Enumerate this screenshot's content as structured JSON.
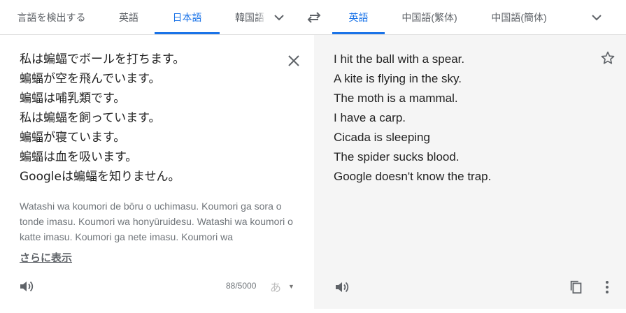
{
  "source_tabs": [
    {
      "label": "言語を検出する",
      "active": false
    },
    {
      "label": "英語",
      "active": false
    },
    {
      "label": "日本語",
      "active": true
    },
    {
      "label": "韓国語",
      "active": false
    }
  ],
  "target_tabs": [
    {
      "label": "英語",
      "active": true
    },
    {
      "label": "中国語(繁体)",
      "active": false
    },
    {
      "label": "中国語(簡体)",
      "active": false
    }
  ],
  "icons": {
    "source_more": "chevron-down-icon",
    "swap": "swap-arrows-icon",
    "target_more": "chevron-down-icon",
    "clear": "close-icon",
    "listen": "speaker-icon",
    "star": "star-outline-icon",
    "copy": "copy-icon",
    "more": "more-vert-icon"
  },
  "source": {
    "lines": [
      "私は蝙蝠でボールを打ちます。",
      "蝙蝠が空を飛んでいます。",
      "蝙蝠は哺乳類です。",
      "私は蝙蝠を飼っています。",
      "蝙蝠が寝ています。",
      "蝙蝠は血を吸います。",
      "Googleは蝙蝠を知りません。"
    ],
    "romanization": "Watashi wa koumori de bōru o uchimasu. Koumori ga sora o tonde imasu. Koumori wa honyūruidesu. Watashi wa koumori o katte imasu. Koumori ga nete imasu. Koumori wa",
    "show_more_label": "さらに表示",
    "char_count": "88/5000",
    "ime_label": "あ"
  },
  "target": {
    "lines": [
      "I hit the ball with a spear.",
      "A kite is flying in the sky.",
      "The moth is a mammal.",
      "I have a carp.",
      "Cicada is sleeping",
      "The spider sucks blood.",
      "Google doesn't know the trap."
    ]
  },
  "colors": {
    "accent": "#1a73e8",
    "text": "#222222",
    "muted": "#5f6368",
    "output_bg": "#f5f5f5"
  }
}
